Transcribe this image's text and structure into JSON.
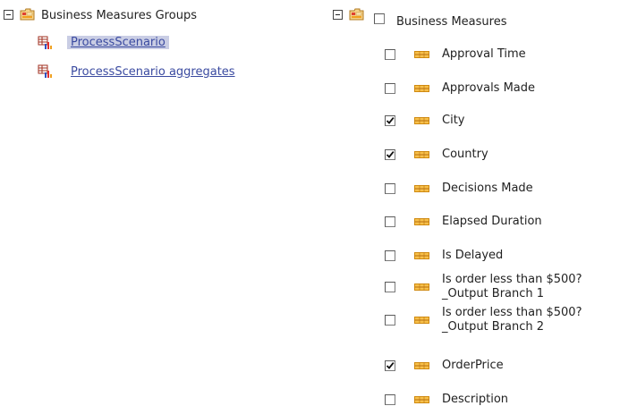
{
  "left_tree": {
    "root_label": "Business Measures Groups",
    "items": [
      {
        "label": "ProcessScenario",
        "selected": true
      },
      {
        "label": "ProcessScenario aggregates",
        "selected": false
      }
    ]
  },
  "right_tree": {
    "root_label": "Business Measures",
    "root_checked": false,
    "items": [
      {
        "label": "Approval Time",
        "checked": false
      },
      {
        "label": "Approvals Made",
        "checked": false
      },
      {
        "label": "City",
        "checked": true
      },
      {
        "label": "Country",
        "checked": true
      },
      {
        "label": "Decisions Made",
        "checked": false
      },
      {
        "label": "Elapsed Duration",
        "checked": false
      },
      {
        "label": "Is Delayed",
        "checked": false
      },
      {
        "label": "Is order less than $500?\n_Output Branch 1",
        "checked": false
      },
      {
        "label": "Is order less than $500?\n_Output Branch 2",
        "checked": false
      },
      {
        "label": "OrderPrice",
        "checked": true
      },
      {
        "label": "Description",
        "checked": false
      }
    ]
  },
  "colors": {
    "link": "#3a4aa0",
    "selection": "#c9cde4",
    "measure_icon": "#f0a020"
  },
  "icons": {
    "expander": "collapse-icon",
    "folder": "business-measures-folder-icon",
    "group": "measure-group-icon",
    "measure": "measure-icon"
  }
}
